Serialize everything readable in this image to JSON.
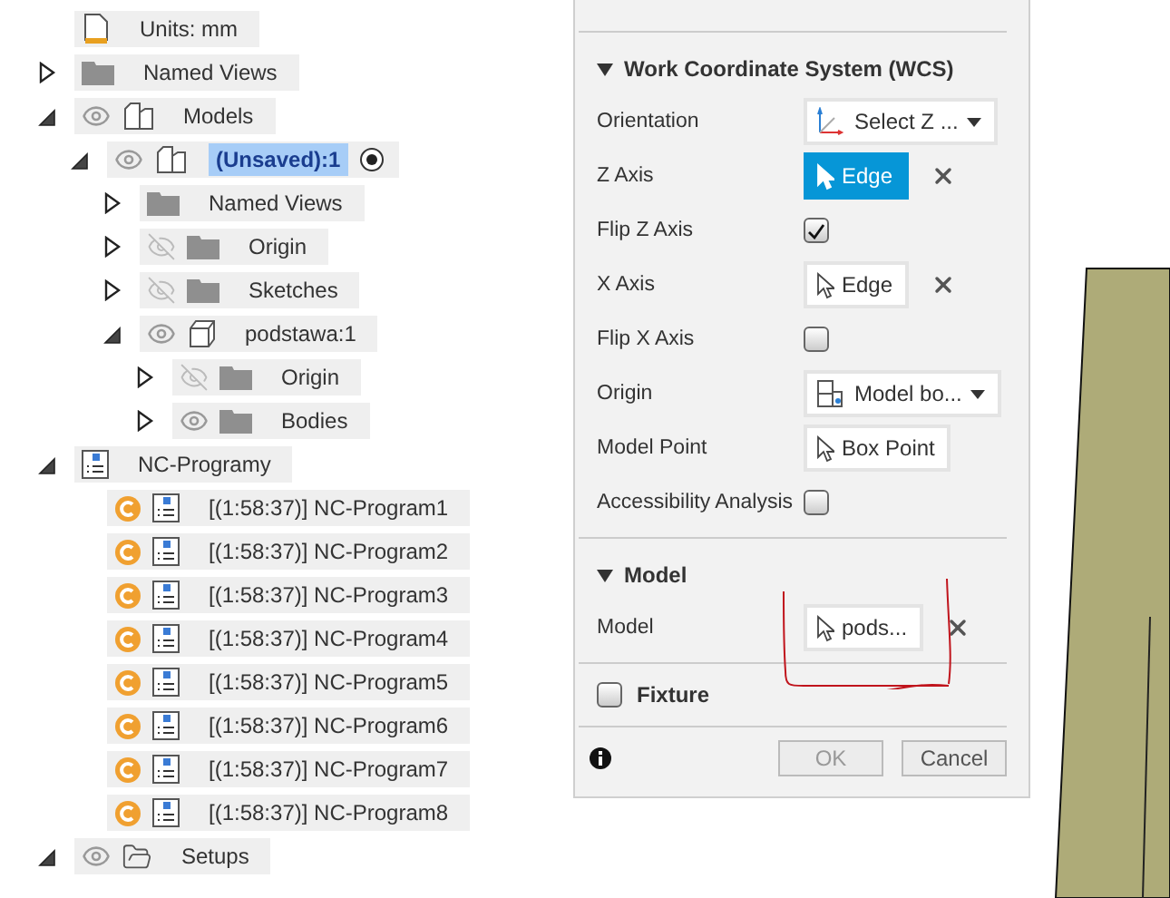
{
  "tree": [
    {
      "kind": "document",
      "label": "Units: mm"
    },
    {
      "kind": "folder",
      "label": "Named Views",
      "expanded": false,
      "selected": false
    },
    {
      "kind": "component",
      "label": "Models",
      "expanded": true,
      "visible": true,
      "selected": false,
      "children": [
        {
          "kind": "component",
          "label": "(Unsaved):1",
          "expanded": true,
          "visible": true,
          "selected": true,
          "activated": true,
          "children": [
            {
              "kind": "folder",
              "label": "Named Views",
              "expanded": false,
              "selected": false
            },
            {
              "kind": "folder",
              "label": "Origin",
              "expanded": false,
              "visible": false,
              "selected": false
            },
            {
              "kind": "folder",
              "label": "Sketches",
              "expanded": false,
              "visible": false,
              "selected": false
            },
            {
              "kind": "body",
              "label": "podstawa:1",
              "expanded": true,
              "visible": true,
              "selected": false,
              "children": [
                {
                  "kind": "folder",
                  "label": "Origin",
                  "expanded": false,
                  "visible": false,
                  "selected": false
                },
                {
                  "kind": "folder",
                  "label": "Bodies",
                  "expanded": false,
                  "visible": true,
                  "selected": false
                }
              ]
            }
          ]
        }
      ]
    },
    {
      "kind": "nc-program",
      "label": "NC-Programy",
      "expanded": true,
      "selected": false,
      "children": [
        {
          "kind": "program",
          "label": "[(1:58:37)] NC-Program1",
          "selected": false
        },
        {
          "kind": "program",
          "label": "[(1:58:37)] NC-Program2",
          "selected": false
        },
        {
          "kind": "program",
          "label": "[(1:58:37)] NC-Program3",
          "selected": false
        },
        {
          "kind": "program",
          "label": "[(1:58:37)] NC-Program4",
          "selected": false
        },
        {
          "kind": "program",
          "label": "[(1:58:37)] NC-Program5",
          "selected": false
        },
        {
          "kind": "program",
          "label": "[(1:58:37)] NC-Program6",
          "selected": false
        },
        {
          "kind": "program",
          "label": "[(1:58:37)] NC-Program7",
          "selected": false
        },
        {
          "kind": "program",
          "label": "[(1:58:37)] NC-Program8",
          "selected": false
        }
      ]
    },
    {
      "kind": "setups",
      "label": "Setups",
      "expanded": true,
      "visible": true,
      "selected": false
    }
  ],
  "dialog": {
    "sections": [
      {
        "title": "Work Coordinate System (WCS)",
        "expanded": true,
        "fields": [
          {
            "label": "Orientation",
            "kind": "dropdown",
            "value": "Select Z ..."
          },
          {
            "label": "Z Axis",
            "kind": "selection",
            "value": "Edge",
            "active": true,
            "clearable": true
          },
          {
            "label": "Flip Z Axis",
            "kind": "checkbox",
            "checked": true
          },
          {
            "label": "X Axis",
            "kind": "selection",
            "value": "Edge",
            "active": false,
            "clearable": true
          },
          {
            "label": "Flip X Axis",
            "kind": "checkbox",
            "checked": false
          },
          {
            "label": "Origin",
            "kind": "dropdown",
            "value": "Model bo..."
          },
          {
            "label": "Model Point",
            "kind": "selection",
            "value": "Box Point",
            "active": false,
            "clearable": false
          },
          {
            "label": "Accessibility Analysis",
            "kind": "checkbox",
            "checked": false
          }
        ]
      },
      {
        "title": "Model",
        "expanded": true,
        "fields": [
          {
            "label": "Model",
            "kind": "selection",
            "value": "pods...",
            "active": false,
            "clearable": true
          }
        ]
      }
    ],
    "fixture": {
      "label": "Fixture",
      "checked": false
    },
    "buttons": [
      {
        "label": "OK",
        "disabled": true
      },
      {
        "label": "Cancel",
        "disabled": false
      }
    ]
  }
}
